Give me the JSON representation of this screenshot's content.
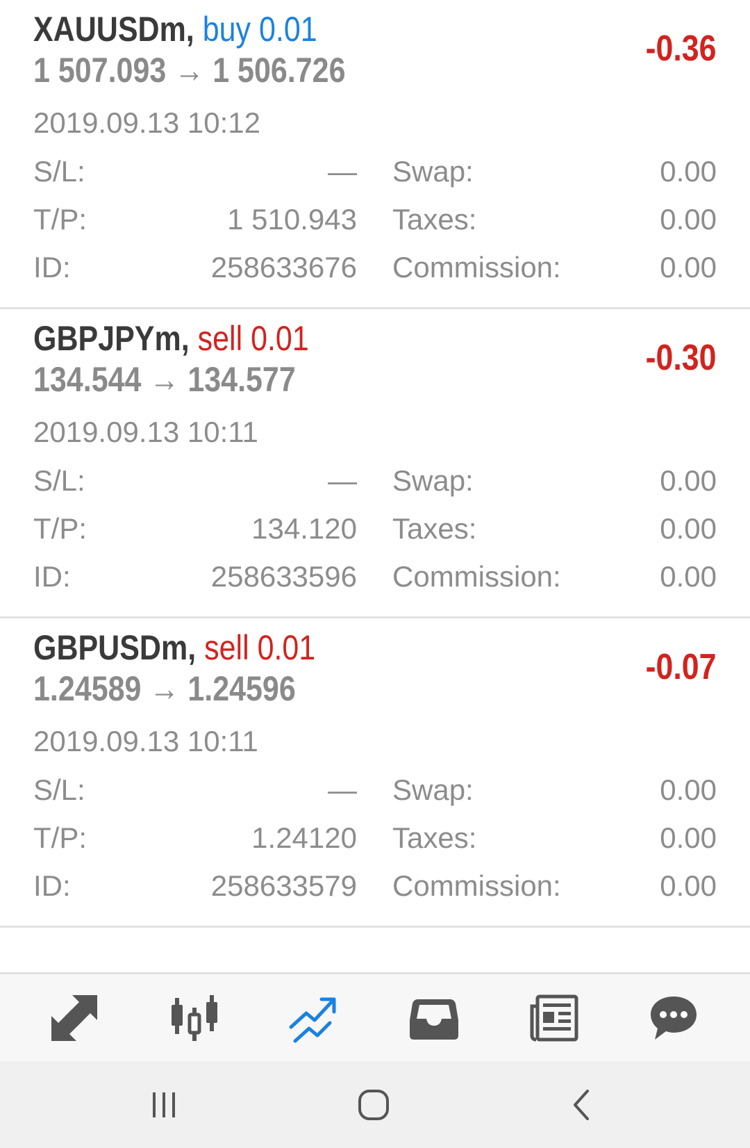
{
  "trades": [
    {
      "symbol": "XAUUSDm,",
      "side": "buy 0.01",
      "side_type": "buy",
      "prices": "1 507.093 → 1 506.726",
      "profit": "-0.36",
      "time": "2019.09.13 10:12",
      "sl_label": "S/L:",
      "sl_value": "—",
      "tp_label": "T/P:",
      "tp_value": "1 510.943",
      "id_label": "ID:",
      "id_value": "258633676",
      "swap_label": "Swap:",
      "swap_value": "0.00",
      "taxes_label": "Taxes:",
      "taxes_value": "0.00",
      "commission_label": "Commission:",
      "commission_value": "0.00"
    },
    {
      "symbol": "GBPJPYm,",
      "side": "sell 0.01",
      "side_type": "sell",
      "prices": "134.544 → 134.577",
      "profit": "-0.30",
      "time": "2019.09.13 10:11",
      "sl_label": "S/L:",
      "sl_value": "—",
      "tp_label": "T/P:",
      "tp_value": "134.120",
      "id_label": "ID:",
      "id_value": "258633596",
      "swap_label": "Swap:",
      "swap_value": "0.00",
      "taxes_label": "Taxes:",
      "taxes_value": "0.00",
      "commission_label": "Commission:",
      "commission_value": "0.00"
    },
    {
      "symbol": "GBPUSDm,",
      "side": "sell 0.01",
      "side_type": "sell",
      "prices": "1.24589 → 1.24596",
      "profit": "-0.07",
      "time": "2019.09.13 10:11",
      "sl_label": "S/L:",
      "sl_value": "—",
      "tp_label": "T/P:",
      "tp_value": "1.24120",
      "id_label": "ID:",
      "id_value": "258633579",
      "swap_label": "Swap:",
      "swap_value": "0.00",
      "taxes_label": "Taxes:",
      "taxes_value": "0.00",
      "commission_label": "Commission:",
      "commission_value": "0.00"
    }
  ],
  "toolbar": {
    "items": [
      {
        "icon": "quotes-icon",
        "active": false
      },
      {
        "icon": "chart-icon",
        "active": false
      },
      {
        "icon": "trade-icon",
        "active": true
      },
      {
        "icon": "history-icon",
        "active": false
      },
      {
        "icon": "news-icon",
        "active": false
      },
      {
        "icon": "chat-icon",
        "active": false
      }
    ],
    "active_color": "#1a82e0",
    "inactive_color": "#555555"
  },
  "colors": {
    "buy": "#1a82e0",
    "sell": "#d2231f",
    "loss": "#d2231f"
  },
  "system_nav": {
    "recent_icon": "recent-apps-icon",
    "home_icon": "home-icon",
    "back_icon": "back-icon"
  }
}
